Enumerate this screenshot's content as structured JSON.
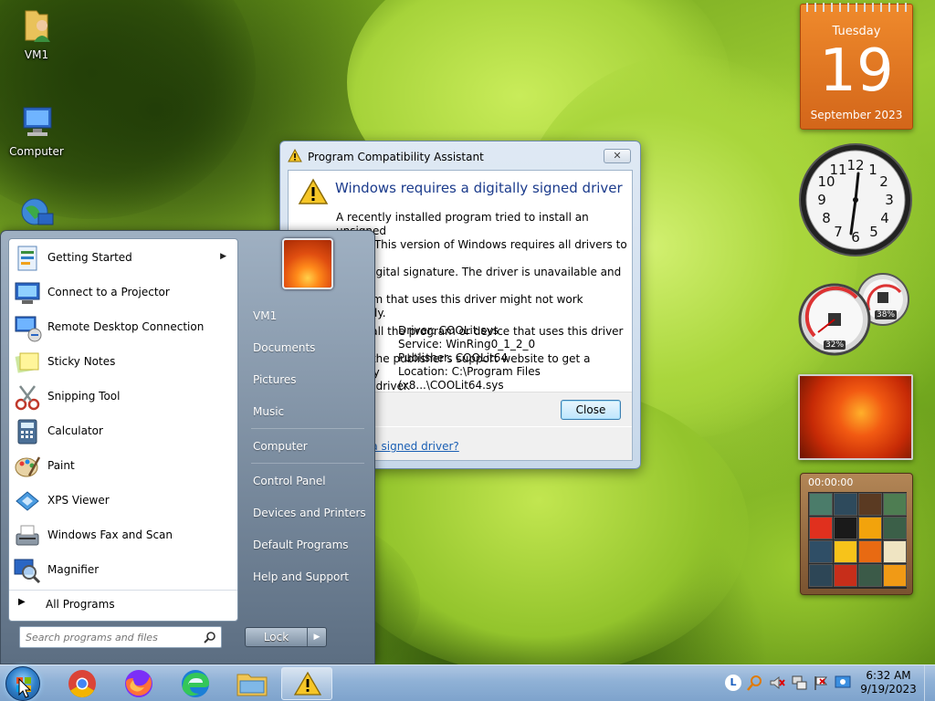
{
  "desktop": {
    "icons": [
      {
        "label": "VM1"
      },
      {
        "label": "Computer"
      }
    ]
  },
  "dialog": {
    "title": "Program Compatibility Assistant",
    "close_glyph": "✕",
    "heading": "Windows requires a digitally signed driver",
    "paragraph1": "A recently installed program tried to install an unsigned driver. This version of Windows requires all drivers to have a valid digital signature. The driver is unavailable and the program that uses this driver might not work correctly.",
    "paragraph2": "Uninstall the program or device that uses this driver and check the publisher's support website to get a digitally signed driver.",
    "paragraph1_visible": [
      "A recently installed program tried to install an unsigned",
      "driver. This version of Windows requires all drivers to have a",
      "valid digital signature. The driver is unavailable and the",
      "program that uses this driver might not work correctly."
    ],
    "paragraph2_visible": [
      "Uninstall the program or device that uses this driver and",
      "check the publisher's support website to get a digitally",
      "signed driver."
    ],
    "details": {
      "driver": "Driver: COOLit.sys",
      "service": "Service: WinRing0_1_2_0",
      "publisher": "Publisher: COOLit64",
      "location": "Location: C:\\Program Files (x8...\\COOLit64.sys"
    },
    "close_button": "Close",
    "link": "Why do I need a signed driver?"
  },
  "start_menu": {
    "programs": [
      {
        "label": "Getting Started",
        "has_submenu": true
      },
      {
        "label": "Connect to a Projector"
      },
      {
        "label": "Remote Desktop Connection"
      },
      {
        "label": "Sticky Notes"
      },
      {
        "label": "Snipping Tool"
      },
      {
        "label": "Calculator"
      },
      {
        "label": "Paint"
      },
      {
        "label": "XPS Viewer"
      },
      {
        "label": "Windows Fax and Scan"
      },
      {
        "label": "Magnifier"
      }
    ],
    "all_programs": "All Programs",
    "search_placeholder": "Search programs and files",
    "right_links": [
      "VM1",
      "Documents",
      "Pictures",
      "Music",
      "Computer",
      "Control Panel",
      "Devices and Printers",
      "Default Programs",
      "Help and Support"
    ],
    "lock_button": "Lock",
    "submenu_arrow": "▶"
  },
  "gadgets": {
    "calendar": {
      "day": "Tuesday",
      "date": "19",
      "month": "September 2023"
    },
    "cpu_meter": {
      "cpu": "32%",
      "memory": "38%"
    },
    "puzzle": {
      "timer": "00:00:00"
    }
  },
  "taskbar": {
    "time": "6:32 AM",
    "date": "9/19/2023",
    "pinned": [
      "start-orb",
      "chrome-icon",
      "firefox-icon",
      "edge-icon",
      "explorer-icon",
      "warning-icon"
    ]
  },
  "colors": {
    "dialog_heading": "#1b3b8c",
    "taskbar": "#8fb1d6",
    "calendar": "#e07a24"
  }
}
